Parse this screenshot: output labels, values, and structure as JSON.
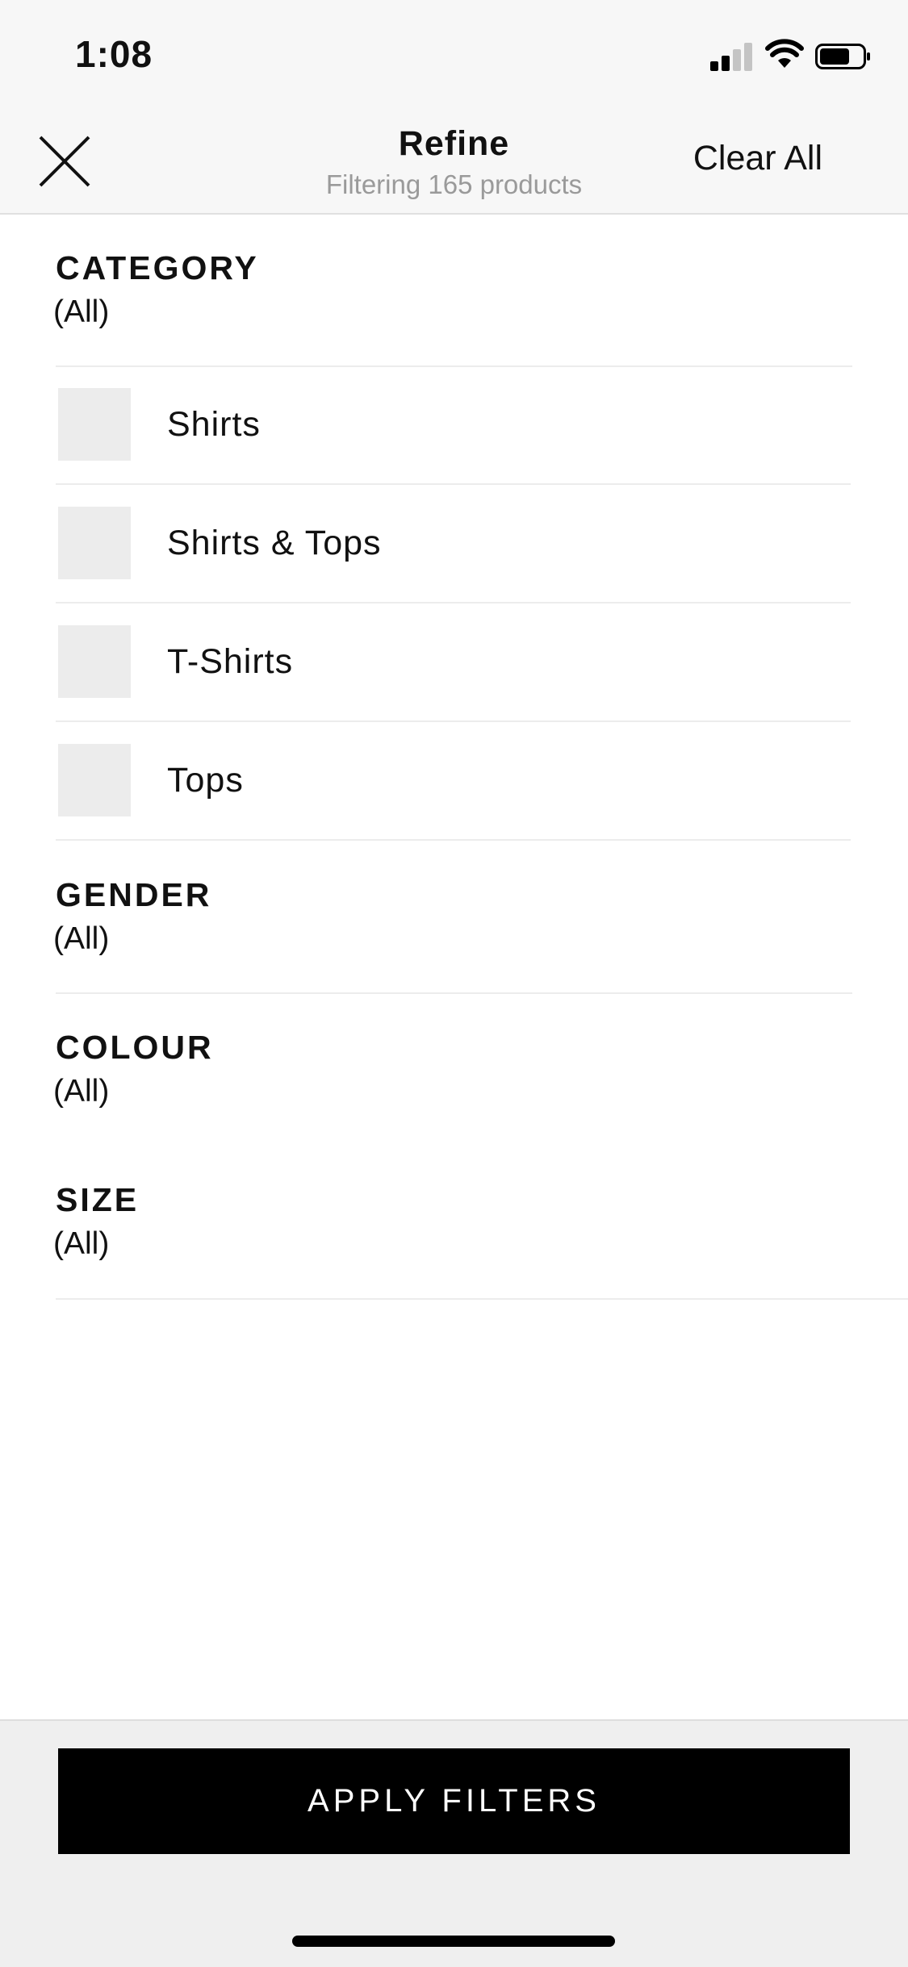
{
  "status_bar": {
    "time": "1:08"
  },
  "header": {
    "title": "Refine",
    "subtitle": "Filtering 165 products",
    "clear_all_label": "Clear All"
  },
  "category": {
    "title": "CATEGORY",
    "value": "(All)",
    "options": [
      {
        "label": "Shirts",
        "checked": false
      },
      {
        "label": "Shirts & Tops",
        "checked": false
      },
      {
        "label": "T-Shirts",
        "checked": false
      },
      {
        "label": "Tops",
        "checked": false
      }
    ]
  },
  "gender": {
    "title": "GENDER",
    "value": "(All)"
  },
  "colour": {
    "title": "COLOUR",
    "value": "(All)"
  },
  "size": {
    "title": "SIZE",
    "value": "(All)"
  },
  "footer": {
    "apply_label": "APPLY FILTERS"
  },
  "colors": {
    "header_bg": "#f7f7f7",
    "checkbox_bg": "#ececec",
    "apply_bg": "#000000",
    "subtitle_text": "#9a9a9a"
  }
}
